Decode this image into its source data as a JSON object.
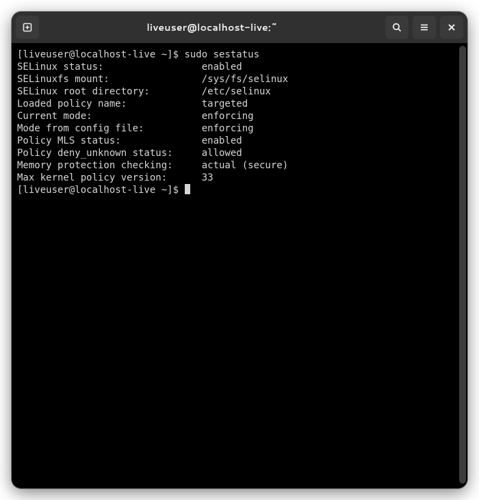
{
  "window": {
    "title": "liveuser@localhost-live:~"
  },
  "titlebar": {
    "new_tab_icon": "new-tab-icon",
    "search_icon": "search-icon",
    "menu_icon": "hamburger-menu-icon",
    "close_icon": "close-icon"
  },
  "terminal": {
    "prompt": "[liveuser@localhost-live ~]$ ",
    "command": "sudo sestatus",
    "lines": [
      {
        "label": "SELinux status:",
        "value": "enabled"
      },
      {
        "label": "SELinuxfs mount:",
        "value": "/sys/fs/selinux"
      },
      {
        "label": "SELinux root directory:",
        "value": "/etc/selinux"
      },
      {
        "label": "Loaded policy name:",
        "value": "targeted"
      },
      {
        "label": "Current mode:",
        "value": "enforcing"
      },
      {
        "label": "Mode from config file:",
        "value": "enforcing"
      },
      {
        "label": "Policy MLS status:",
        "value": "enabled"
      },
      {
        "label": "Policy deny_unknown status:",
        "value": "allowed"
      },
      {
        "label": "Memory protection checking:",
        "value": "actual (secure)"
      },
      {
        "label": "Max kernel policy version:",
        "value": "33"
      }
    ],
    "prompt2": "[liveuser@localhost-live ~]$ "
  }
}
